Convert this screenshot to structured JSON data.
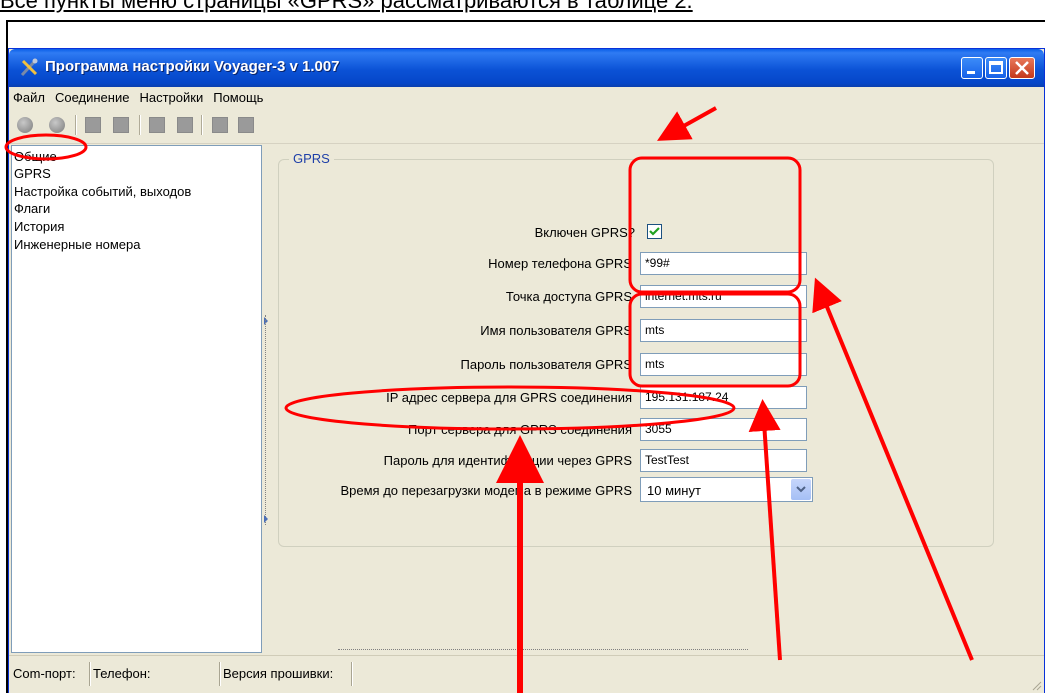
{
  "caption": "Все пункты меню страницы «GPRS» рассматриваются в таблице 2.",
  "window": {
    "title": "Программа настройки Voyager-3 v 1.007"
  },
  "menu": [
    "Файл",
    "Соединение",
    "Настройки",
    "Помощь"
  ],
  "sidebar": {
    "items": [
      {
        "label": "Общие"
      },
      {
        "label": "GPRS"
      },
      {
        "label": "Настройка событий, выходов"
      },
      {
        "label": "Флаги"
      },
      {
        "label": "История"
      },
      {
        "label": "Инженерные номера"
      }
    ]
  },
  "gprs": {
    "group_title": "GPRS",
    "enabled": {
      "label": "Включен GPRS?",
      "checked": true
    },
    "phone": {
      "label": "Номер телефона GPRS",
      "value": "*99#"
    },
    "apn": {
      "label": "Точка доступа GPRS",
      "value": "internet.mts.ru"
    },
    "user": {
      "label": "Имя пользователя GPRS",
      "value": "mts"
    },
    "password": {
      "label": "Пароль пользователя GPRS",
      "value": "mts"
    },
    "server_ip": {
      "label": "IP адрес сервера для GPRS соединения",
      "value": "195.131.187.24"
    },
    "server_port": {
      "label": "Порт сервера для GPRS соединения",
      "value": "3055"
    },
    "ident_password": {
      "label": "Пароль для идентификации через GPRS",
      "value": "TestTest"
    },
    "modem_restart": {
      "label": "Время до перезагрузки модема в режиме GPRS",
      "value": "10 минут"
    }
  },
  "statusbar": {
    "com_port": "Com-порт:",
    "phone": "Телефон:",
    "firmware": "Версия прошивки:"
  },
  "colors": {
    "annotation": "#ff0000",
    "titlebar": "#0b52d6",
    "group_title": "#1e3fa8"
  }
}
